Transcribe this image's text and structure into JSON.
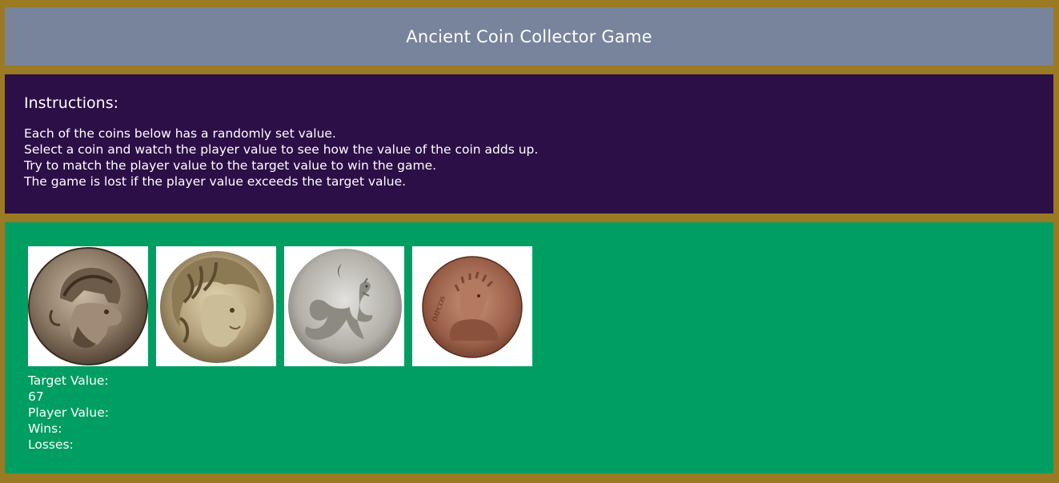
{
  "header": {
    "title": "Ancient Coin Collector Game"
  },
  "instructions": {
    "heading": "Instructions:",
    "lines": [
      "Each of the coins below has a randomly set value.",
      "Select a coin and watch the player value to see how the value of the coin adds up.",
      "Try to match the player value to the target value to win the game.",
      "The game is lost if the player value exceeds the target value."
    ]
  },
  "coins": [
    {
      "icon": "helmeted-warrior-coin-icon"
    },
    {
      "icon": "lion-headdress-coin-icon"
    },
    {
      "icon": "sea-serpent-coin-icon"
    },
    {
      "icon": "emperor-portrait-coin-icon"
    }
  ],
  "stats": {
    "target_label": "Target Value:",
    "target_value": "67",
    "player_label": "Player Value:",
    "wins_label": "Wins:",
    "losses_label": "Losses:"
  }
}
